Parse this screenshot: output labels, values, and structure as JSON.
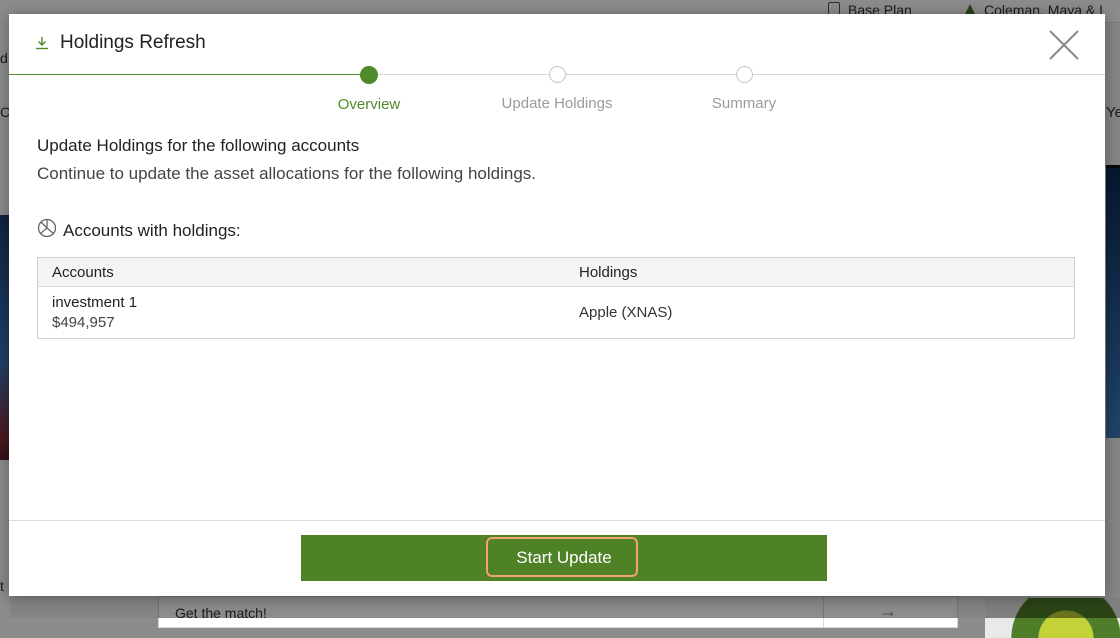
{
  "background": {
    "tabs": [
      {
        "label": "Base Plan",
        "icon": "document-icon"
      },
      {
        "label": "Coleman, Maya & I",
        "icon": "tree-icon"
      }
    ],
    "right_edge_text": "Ye",
    "bottom_card_text": "Get the match!",
    "left_edge_letters": [
      "d",
      "C",
      "t"
    ]
  },
  "modal": {
    "title": "Holdings Refresh",
    "title_icon": "download-icon",
    "close_icon": "close-icon",
    "stepper": [
      {
        "label": "Overview",
        "state": "active"
      },
      {
        "label": "Update Holdings",
        "state": "pending"
      },
      {
        "label": "Summary",
        "state": "pending"
      }
    ],
    "section_title": "Update Holdings for the following accounts",
    "section_description": "Continue to update the asset allocations for the following holdings.",
    "accounts_header": "Accounts with holdings:",
    "accounts_icon": "pie-chart-icon",
    "table": {
      "columns": [
        "Accounts",
        "Holdings"
      ],
      "rows": [
        {
          "account": "investment 1",
          "value": "$494,957",
          "holding": "Apple (XNAS)"
        }
      ]
    },
    "start_button_label": "Start Update"
  },
  "colors": {
    "accent_green": "#4f8227",
    "focus_orange": "#f0a36a"
  }
}
